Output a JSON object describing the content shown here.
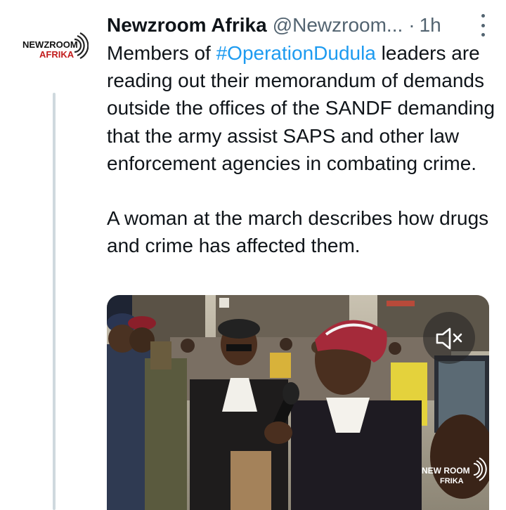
{
  "tweet": {
    "author_name": "Newzroom Afrika",
    "author_handle": "@Newzroom...",
    "separator": "·",
    "time": "1h",
    "avatar": {
      "line1": "NEWZROOM",
      "line2": "AFRIKA"
    },
    "text_para1_prefix": "Members of ",
    "hashtag": "#OperationDudula",
    "text_para1_suffix": " leaders are reading out their memorandum of demands outside the offices of the SANDF demanding that the army assist SAPS and other law enforcement agencies in combating crime.",
    "text_para2": "A woman at the march describes how drugs and crime has affected them."
  },
  "media": {
    "watermark_line1": "NEW ROOM",
    "watermark_line2": "FRIKA",
    "mute_icon": "speaker-muted-icon"
  },
  "colors": {
    "text": "#0f1419",
    "secondary": "#536471",
    "link": "#1d9bf0",
    "thread_line": "#cfd9de"
  }
}
